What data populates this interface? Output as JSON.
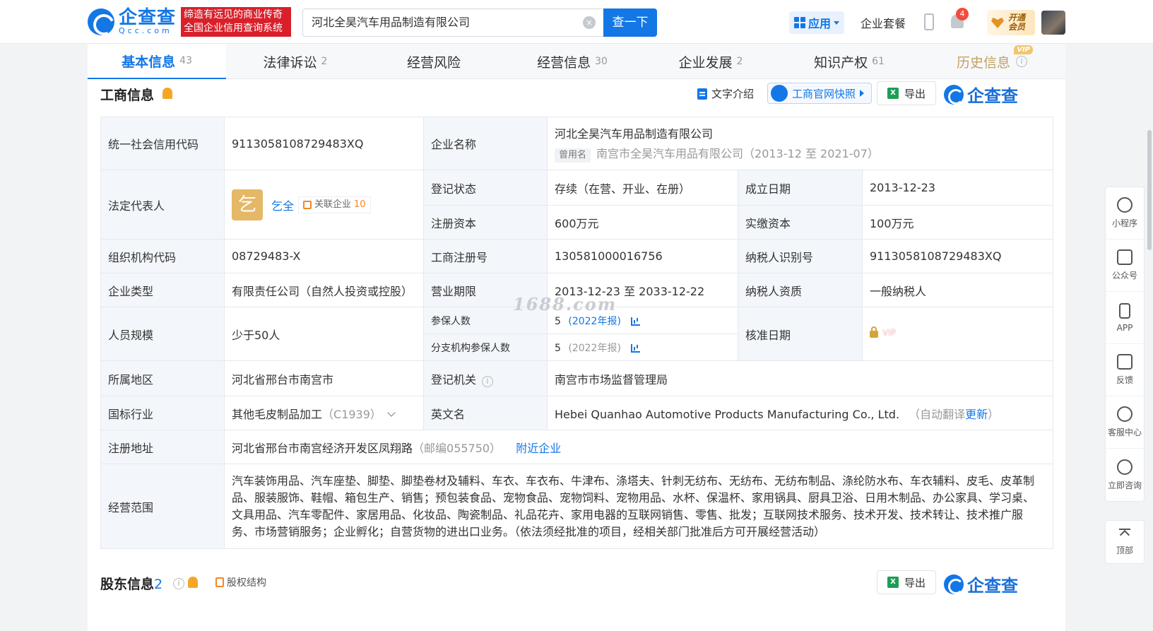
{
  "header": {
    "logo_cn": "企查查",
    "logo_en": "Qcc.com",
    "slogan_line1": "缔造有远见的商业传奇",
    "slogan_line2": "全国企业信用查询系统",
    "search_value": "河北全昊汽车用品制造有限公司",
    "search_button": "查一下",
    "app_label": "应用",
    "suite_label": "企业套餐",
    "notification_count": "4",
    "vip_line1": "开通",
    "vip_line2": "会员"
  },
  "tabs": [
    {
      "label": "基本信息",
      "count": "43"
    },
    {
      "label": "法律诉讼",
      "count": "2"
    },
    {
      "label": "经营风险",
      "count": ""
    },
    {
      "label": "经营信息",
      "count": "30"
    },
    {
      "label": "企业发展",
      "count": "2"
    },
    {
      "label": "知识产权",
      "count": "61"
    },
    {
      "label": "历史信息",
      "count": "",
      "vip": "VIP"
    }
  ],
  "business_section": {
    "title": "工商信息",
    "text_intro": "文字介绍",
    "snapshot": "工商官网快照",
    "export": "导出",
    "brand": "企查查"
  },
  "business_info": {
    "credit_code_label": "统一社会信用代码",
    "credit_code": "9113058108729483XQ",
    "company_name_label": "企业名称",
    "company_name": "河北全昊汽车用品制造有限公司",
    "former_name_tag": "曾用名",
    "former_name": "南宫市全昊汽车用品有限公司（2013-12 至 2021-07）",
    "legal_rep_label": "法定代表人",
    "legal_rep_avatar": "乞",
    "legal_rep_name": "乞全",
    "assoc_label": "关联企业",
    "assoc_count": "10",
    "reg_status_label": "登记状态",
    "reg_status": "存续（在营、开业、在册）",
    "est_date_label": "成立日期",
    "est_date": "2013-12-23",
    "reg_capital_label": "注册资本",
    "reg_capital": "600万元",
    "paid_capital_label": "实缴资本",
    "paid_capital": "100万元",
    "org_code_label": "组织机构代码",
    "org_code": "08729483-X",
    "biz_reg_no_label": "工商注册号",
    "biz_reg_no": "130581000016756",
    "taxpayer_id_label": "纳税人识别号",
    "taxpayer_id": "9113058108729483XQ",
    "company_type_label": "企业类型",
    "company_type": "有限责任公司（自然人投资或控股）",
    "biz_term_label": "营业期限",
    "biz_term": "2013-12-23 至 2033-12-22",
    "taxpayer_qual_label": "纳税人资质",
    "taxpayer_qual": "一般纳税人",
    "staff_size_label": "人员规模",
    "staff_size": "少于50人",
    "insured_label": "参保人数",
    "insured": "5",
    "insured_year": "(2022年报)",
    "branch_insured_label": "分支机构参保人数",
    "branch_insured": "5",
    "branch_insured_year": "(2022年报)",
    "approval_date_label": "核准日期",
    "approval_vip": "VIP",
    "region_label": "所属地区",
    "region": "河北省邢台市南宫市",
    "reg_authority_label": "登记机关",
    "reg_authority": "南宫市市场监督管理局",
    "industry_label": "国标行业",
    "industry": "其他毛皮制品加工",
    "industry_code": "（C1939）",
    "english_name_label": "英文名",
    "english_name": "Hebei Quanhao Automotive Products Manufacturing Co., Ltd.",
    "auto_translate_pre": "（自动翻译",
    "auto_translate_link": "更新",
    "auto_translate_post": "）",
    "address_label": "注册地址",
    "address": "河北省邢台市南宫经济开发区凤翔路",
    "postal": "（邮编055750）",
    "nearby": "附近企业",
    "scope_label": "经营范围",
    "scope": "汽车装饰用品、汽车座垫、脚垫、脚垫卷材及辅料、车衣、车衣布、牛津布、涤塔夫、针刺无纺布、无纺布、无纺布制品、涤纶防水布、车衣辅料、皮毛、皮革制品、服装服饰、鞋帽、箱包生产、销售；预包装食品、宠物食品、宠物饲料、宠物用品、水杯、保温杯、家用锅具、厨具卫浴、日用木制品、办公家具、学习桌、文具用品、汽车零配件、家居用品、化妆品、陶瓷制品、礼品花卉、家用电器的互联网销售、零售、批发；互联网技术服务、技术开发、技术转让、技术推广服务、市场营销服务；企业孵化；自营货物的进出口业务。（依法须经批准的项目，经相关部门批准后方可开展经营活动）"
  },
  "watermark": "1688.com",
  "shareholder_section": {
    "title": "股东信息",
    "count": "2",
    "equity_structure": "股权结构",
    "export": "导出",
    "brand": "企查查"
  },
  "rail": [
    {
      "label": "小程序"
    },
    {
      "label": "公众号"
    },
    {
      "label": "APP"
    },
    {
      "label": "反馈"
    },
    {
      "label": "客服中心"
    },
    {
      "label": "立即咨询"
    }
  ],
  "rail_top": "顶部",
  "colors": {
    "primary": "#1377e6",
    "slogan_bg": "#d9202a",
    "label_bg": "#f3f6fb"
  }
}
